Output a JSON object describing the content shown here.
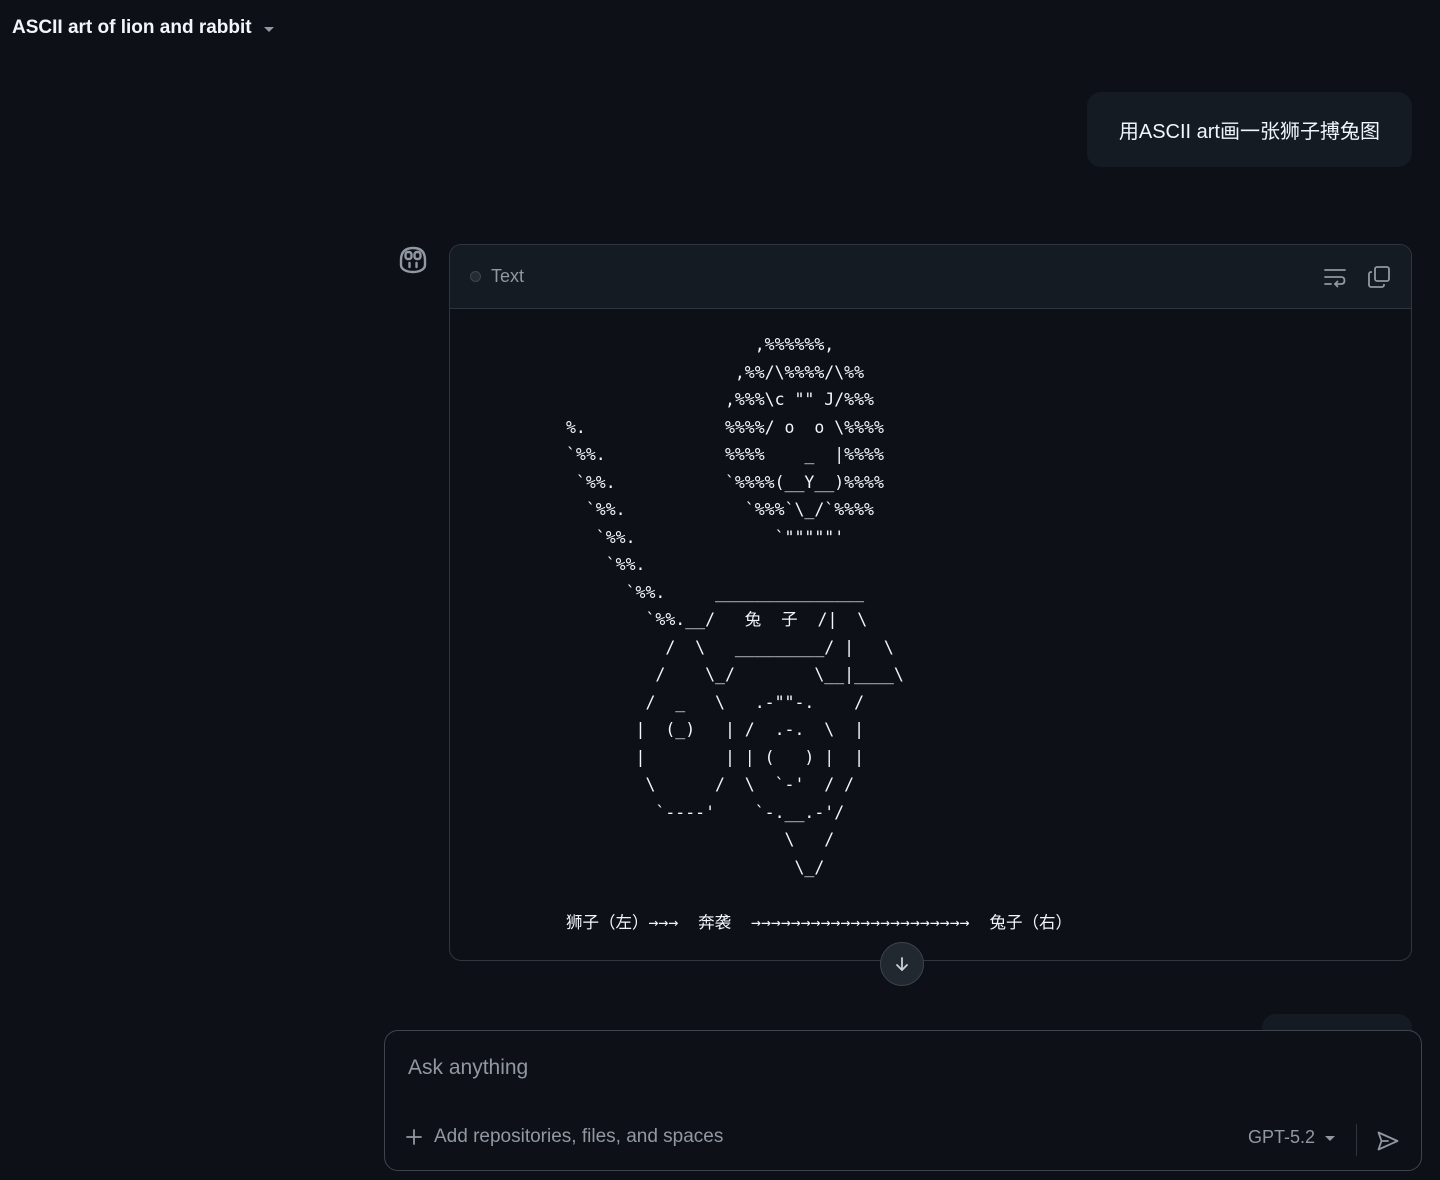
{
  "header": {
    "conversation_title": "ASCII art of lion and rabbit",
    "title_menu_icon": "chevron-down-icon"
  },
  "messages": {
    "user_prompt": "用ASCII art画一张狮子搏兔图",
    "assistant": {
      "avatar_icon": "copilot-icon",
      "code_block": {
        "language": "Text",
        "wrap_icon": "word-wrap-icon",
        "copy_icon": "copy-icon",
        "content": "                   ,%%%%%%,\n                 ,%%/\\%%%%/\\%%\n                ,%%%\\c \"\" J/%%%\n%.              %%%%/ o  o \\%%%%\n`%%.            %%%%    _  |%%%%\n `%%.           `%%%%(__Y__)%%%%\n  `%%.            `%%%`\\_/`%%%%\n   `%%.              `\"\"\"\"\"'\n    `%%.\n      `%%.     _______________\n        `%%.__/   兔  子  /|  \\\n          /  \\   _________/ |   \\\n         /    \\_/        \\__|____\\\n        /  _   \\   .-\"\"-.    /\n       |  (_)   | /  .-.  \\  |\n       |        | | (   ) |  |\n        \\      /  \\  `-'  / /\n         `----'    `-.__.-'/\n                      \\   /\n                       \\_/\n\n狮子（左）→→→  奔袭  →→→→→→→→→→→→→→→→→→→→→→  兔子（右）"
      }
    }
  },
  "scroll_button_icon": "arrow-down-icon",
  "composer": {
    "placeholder": "Ask anything",
    "add_icon": "plus-icon",
    "add_label": "Add repositories, files, and spaces",
    "model_label": "GPT-5.2",
    "model_caret_icon": "chevron-down-icon",
    "send_icon": "send-icon"
  }
}
